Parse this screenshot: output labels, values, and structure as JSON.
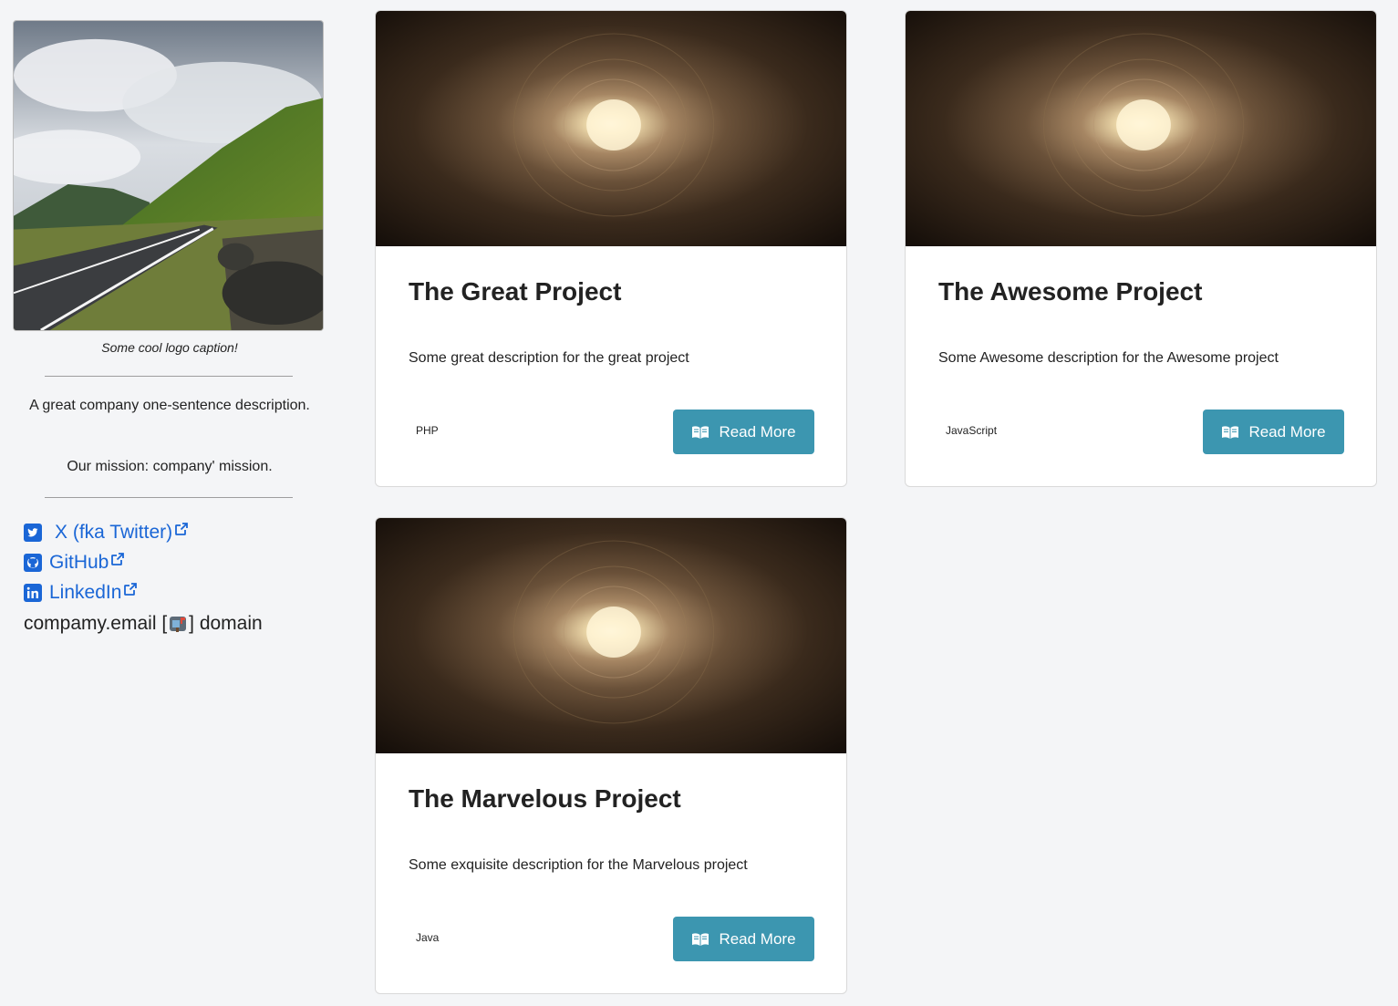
{
  "sidebar": {
    "logo_caption": "Some cool logo caption!",
    "description": "A great company one-sentence description.",
    "mission": "Our mission: company' mission.",
    "social": [
      {
        "label": "X (fka Twitter)",
        "icon": "twitter-square-icon"
      },
      {
        "label": "GitHub",
        "icon": "github-square-icon"
      },
      {
        "label": "LinkedIn",
        "icon": "linkedin-square-icon"
      }
    ],
    "email": {
      "prefix": "compamy.email [",
      "suffix": "] domain",
      "icon": "mailbox-icon"
    },
    "link_color": "#1a66d6"
  },
  "projects": [
    {
      "title": "The Great Project",
      "description": "Some great description for the great project",
      "tag": "PHP",
      "button": "Read More"
    },
    {
      "title": "The Awesome Project",
      "description": "Some Awesome description for the Awesome project",
      "tag": "JavaScript",
      "button": "Read More"
    },
    {
      "title": "The Marvelous Project",
      "description": "Some exquisite description for the Marvelous project",
      "tag": "Java",
      "button": "Read More"
    }
  ],
  "colors": {
    "button": "#3c96b0",
    "background": "#f4f5f7"
  }
}
